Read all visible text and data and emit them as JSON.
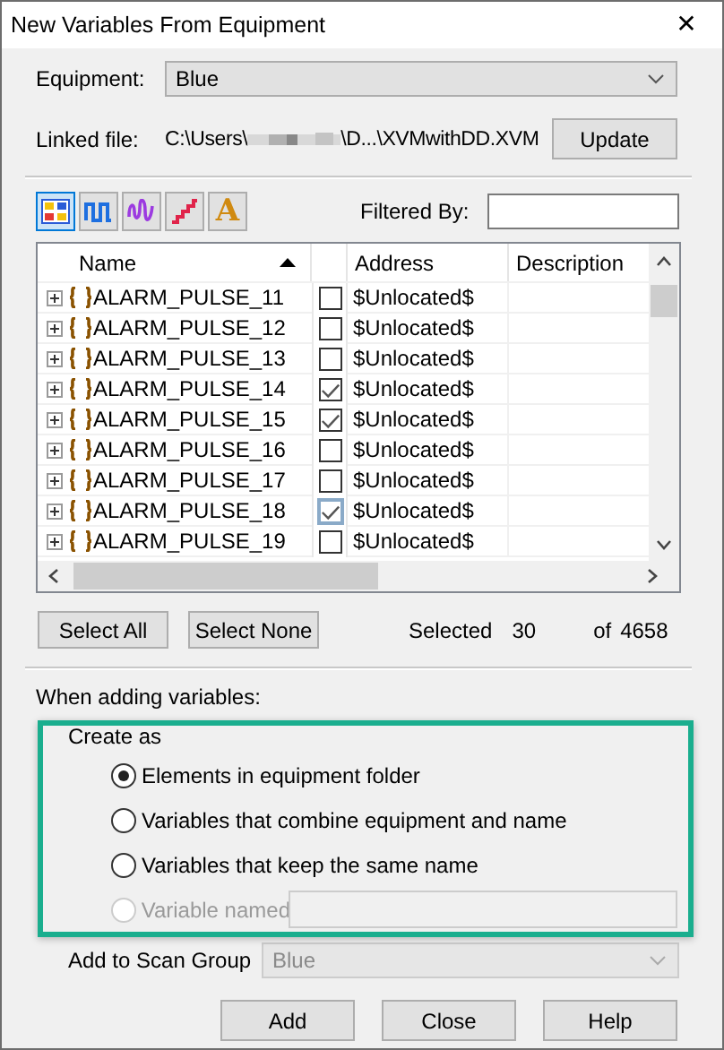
{
  "window": {
    "title": "New Variables From Equipment",
    "close": "✕"
  },
  "equipment": {
    "label": "Equipment:",
    "value": "Blue"
  },
  "linked_file": {
    "label": "Linked file:",
    "path_start": "C:\\Users\\",
    "path_end": "\\D...\\XVMwithDD.XVM",
    "button": "Update"
  },
  "toolbar": {
    "buttons": [
      {
        "kind": "grid",
        "selected": true
      },
      {
        "kind": "pulse",
        "selected": false
      },
      {
        "kind": "wave",
        "selected": false
      },
      {
        "kind": "steps",
        "selected": false
      },
      {
        "kind": "letter",
        "label": "A",
        "selected": false
      }
    ],
    "filter": {
      "label": "Filtered By:"
    }
  },
  "table": {
    "columns": [
      {
        "label": "Name",
        "sorted": true
      },
      {
        "label": "Address"
      },
      {
        "label": "Description"
      }
    ],
    "rows": [
      {
        "name": "ALARM_PULSE_11",
        "checked": false,
        "focused": false,
        "address": "$Unlocated$"
      },
      {
        "name": "ALARM_PULSE_12",
        "checked": false,
        "focused": false,
        "address": "$Unlocated$"
      },
      {
        "name": "ALARM_PULSE_13",
        "checked": false,
        "focused": false,
        "address": "$Unlocated$"
      },
      {
        "name": "ALARM_PULSE_14",
        "checked": true,
        "focused": false,
        "address": "$Unlocated$"
      },
      {
        "name": "ALARM_PULSE_15",
        "checked": true,
        "focused": false,
        "address": "$Unlocated$"
      },
      {
        "name": "ALARM_PULSE_16",
        "checked": false,
        "focused": false,
        "address": "$Unlocated$"
      },
      {
        "name": "ALARM_PULSE_17",
        "checked": false,
        "focused": false,
        "address": "$Unlocated$"
      },
      {
        "name": "ALARM_PULSE_18",
        "checked": true,
        "focused": true,
        "address": "$Unlocated$"
      },
      {
        "name": "ALARM_PULSE_19",
        "checked": false,
        "focused": false,
        "address": "$Unlocated$"
      }
    ]
  },
  "selection": {
    "buttons": [
      "Select All",
      "Select None"
    ],
    "selected_label": "Selected",
    "selected_count": "30",
    "of_label": "of",
    "total": "4658"
  },
  "options": {
    "heading": "When adding variables:",
    "group_label": "Create as",
    "radios": [
      {
        "label": "Elements in equipment folder",
        "selected": true,
        "disabled": false
      },
      {
        "label": "Variables that combine equipment and name",
        "selected": false,
        "disabled": false
      },
      {
        "label": "Variables that keep the same name",
        "selected": false,
        "disabled": false
      },
      {
        "label": "Variable named",
        "selected": false,
        "disabled": true
      }
    ],
    "scan_group": {
      "label": "Add to Scan Group",
      "value": "Blue",
      "disabled": true
    }
  },
  "buttons": [
    "Add",
    "Close",
    "Help"
  ]
}
